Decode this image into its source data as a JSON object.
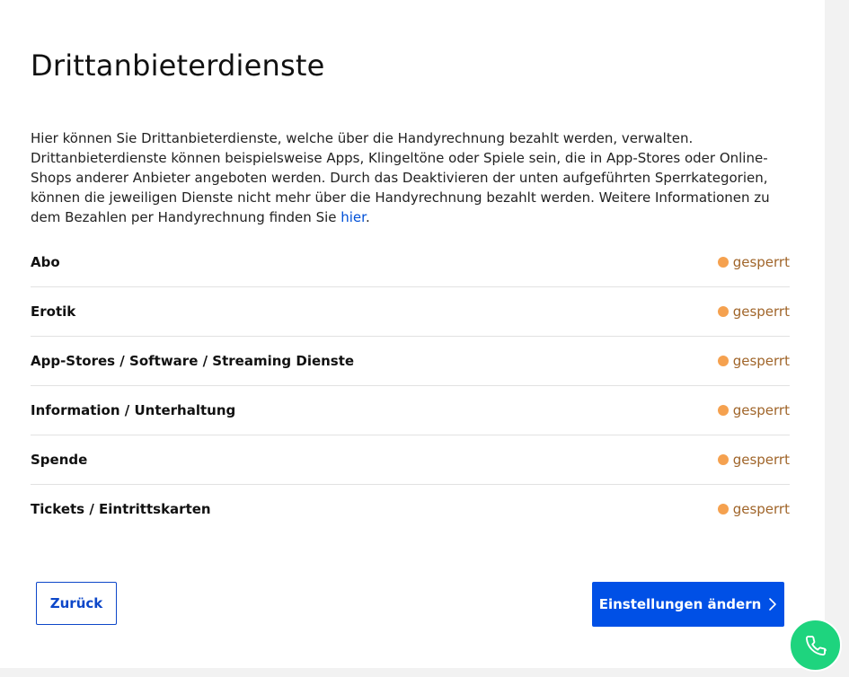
{
  "page": {
    "title": "Drittanbieterdienste",
    "intro_text": "Hier können Sie Drittanbieterdienste, welche über die Handyrechnung bezahlt werden, verwalten. Drittanbieterdienste können beispielsweise Apps, Klingeltöne oder Spiele sein, die in App-Stores oder Online-Shops anderer Anbieter angeboten werden. Durch das Deaktivieren der unten aufgeführten Sperrkategorien, können die jeweiligen Dienste nicht mehr über die Handyrechnung bezahlt werden. Weitere Informationen zu dem Bezahlen per Handyrechnung finden Sie ",
    "intro_link": "hier",
    "intro_end": "."
  },
  "categories": [
    {
      "label": "Abo",
      "status": "gesperrt"
    },
    {
      "label": "Erotik",
      "status": "gesperrt"
    },
    {
      "label": "App-Stores / Software / Streaming Dienste",
      "status": "gesperrt"
    },
    {
      "label": "Information / Unterhaltung",
      "status": "gesperrt"
    },
    {
      "label": "Spende",
      "status": "gesperrt"
    },
    {
      "label": "Tickets / Eintrittskarten",
      "status": "gesperrt"
    }
  ],
  "actions": {
    "back_label": "Zurück",
    "change_label": "Einstellungen ändern"
  },
  "icons": {
    "status": "status-dot-icon",
    "chevron": "chevron-right-icon",
    "call": "phone-icon"
  },
  "colors": {
    "primary": "#0050e6",
    "status_dot": "#f5a14f",
    "status_text": "#a0652a",
    "link": "#0050d7",
    "fab": "#1ed47e"
  }
}
